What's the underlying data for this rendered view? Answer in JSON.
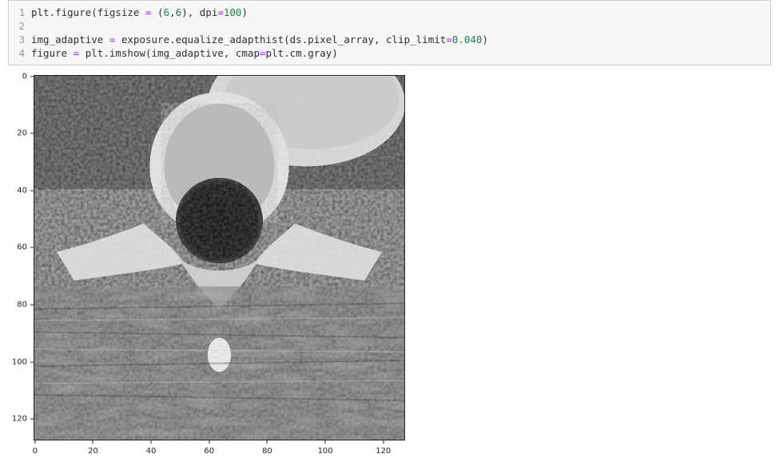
{
  "code": {
    "line_numbers": [
      "1",
      "2",
      "3",
      "4"
    ],
    "line1": {
      "p1": "plt.figure(figsize ",
      "eq1": "=",
      "p2": " (",
      "n1": "6",
      "p3": ",",
      "n2": "6",
      "p4": "), dpi",
      "eq2": "=",
      "n3": "100",
      "p5": ")"
    },
    "line2": "",
    "line3": {
      "p1": "img_adaptive ",
      "eq1": "=",
      "p2": " exposure.equalize_adapthist(ds.pixel_array, clip_limit",
      "eq2": "=",
      "n1": "0.040",
      "p3": ")"
    },
    "line4": {
      "p1": "figure ",
      "eq1": "=",
      "p2": " plt.imshow(img_adaptive, cmap",
      "eq2": "=",
      "p3": "plt.cm.gray)"
    }
  },
  "chart_data": {
    "type": "heatmap",
    "title": "",
    "xlabel": "",
    "ylabel": "",
    "x_ticks": [
      "0",
      "20",
      "40",
      "60",
      "80",
      "100",
      "120"
    ],
    "y_ticks": [
      "0",
      "20",
      "40",
      "60",
      "80",
      "100",
      "120"
    ],
    "xlim": [
      -0.5,
      127.5
    ],
    "ylim": [
      127.5,
      -0.5
    ],
    "cmap": "gray",
    "description": "Adaptive-histogram-equalized grayscale CT-like medical image, 128x128 pixel array"
  },
  "plot": {
    "y_ticks": [
      {
        "label": "0",
        "pos_pct": 0.39
      },
      {
        "label": "20",
        "pos_pct": 16.02
      },
      {
        "label": "40",
        "pos_pct": 31.64
      },
      {
        "label": "60",
        "pos_pct": 47.27
      },
      {
        "label": "80",
        "pos_pct": 62.89
      },
      {
        "label": "100",
        "pos_pct": 78.52
      },
      {
        "label": "120",
        "pos_pct": 94.14
      }
    ],
    "x_ticks": [
      {
        "label": "0",
        "pos_pct": 0.39
      },
      {
        "label": "20",
        "pos_pct": 16.02
      },
      {
        "label": "40",
        "pos_pct": 31.64
      },
      {
        "label": "60",
        "pos_pct": 47.27
      },
      {
        "label": "80",
        "pos_pct": 62.89
      },
      {
        "label": "100",
        "pos_pct": 78.52
      },
      {
        "label": "120",
        "pos_pct": 94.14
      }
    ]
  }
}
